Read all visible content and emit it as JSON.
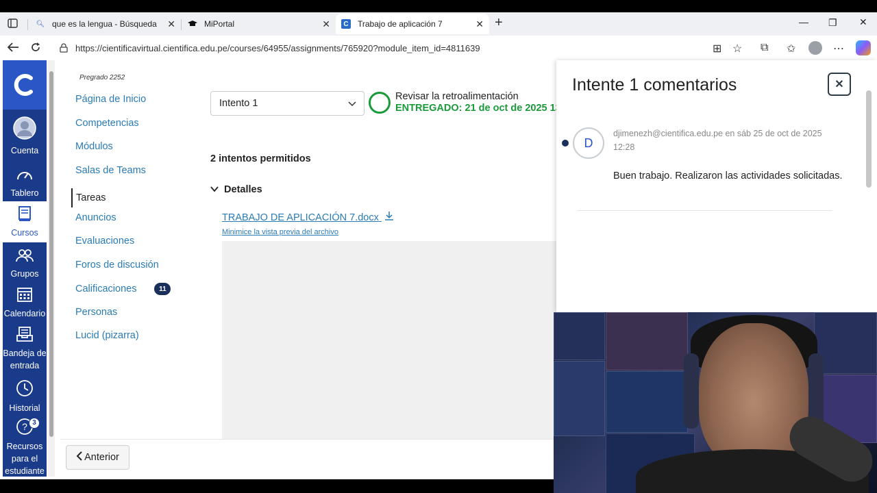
{
  "browser": {
    "tabs": [
      {
        "title": "que es la lengua - Búsqueda",
        "icon": "search-icon"
      },
      {
        "title": "MiPortal",
        "icon": "graduation-cap-icon"
      },
      {
        "title": "Trabajo de aplicación 7",
        "icon": "canvas-c-icon",
        "active": true
      }
    ],
    "new_tab": "+",
    "url": "https://cientificavirtual.cientifica.edu.pe/courses/64955/assignments/765920?module_item_id=4811639"
  },
  "global_nav": {
    "items": [
      {
        "label": "Cuenta",
        "icon": "account-avatar-icon"
      },
      {
        "label": "Tablero",
        "icon": "dashboard-gauge-icon"
      },
      {
        "label": "Cursos",
        "icon": "courses-book-icon",
        "active": true
      },
      {
        "label": "Grupos",
        "icon": "groups-people-icon"
      },
      {
        "label": "Calendario",
        "icon": "calendar-icon"
      },
      {
        "label": "Bandeja de entrada",
        "icon": "inbox-icon"
      },
      {
        "label": "Historial",
        "icon": "history-clock-icon"
      },
      {
        "label": "Recursos para el estudiante",
        "icon": "help-icon",
        "badge": "3"
      }
    ]
  },
  "course_nav": {
    "term": "Pregrado 2252",
    "items": [
      {
        "label": "Página de Inicio"
      },
      {
        "label": "Competencias"
      },
      {
        "label": "Módulos"
      },
      {
        "label": "Salas de Teams"
      },
      {
        "label": "Tareas",
        "active": true
      },
      {
        "label": "Anuncios"
      },
      {
        "label": "Evaluaciones"
      },
      {
        "label": "Foros de discusión"
      },
      {
        "label": "Calificaciones",
        "badge": "11"
      },
      {
        "label": "Personas"
      },
      {
        "label": "Lucid (pizarra)"
      }
    ]
  },
  "submission": {
    "attempt_selected": "Intento 1",
    "feedback_label": "Revisar la retroalimentación",
    "status": "ENTREGADO: 21 de oct de 2025 13:",
    "attempts_allowed": "2 intentos permitidos",
    "details_label": "Detalles",
    "file_name": "TRABAJO DE APLICACIÓN 7.docx",
    "minimize_label": "Minimice la vista previa del archivo"
  },
  "footer": {
    "prev_label": "Anterior"
  },
  "comments": {
    "title": "Intente 1 comentarios",
    "avatar_initial": "D",
    "author_line": "djimenezh@cientifica.edu.pe en sáb 25 de oct de 2025 12:28",
    "text": "Buen trabajo. Realizaron las actividades solicitadas."
  },
  "colors": {
    "canvas_nav": "#1a3a8a",
    "link": "#2a7bb5",
    "success": "#1b9a3a"
  }
}
